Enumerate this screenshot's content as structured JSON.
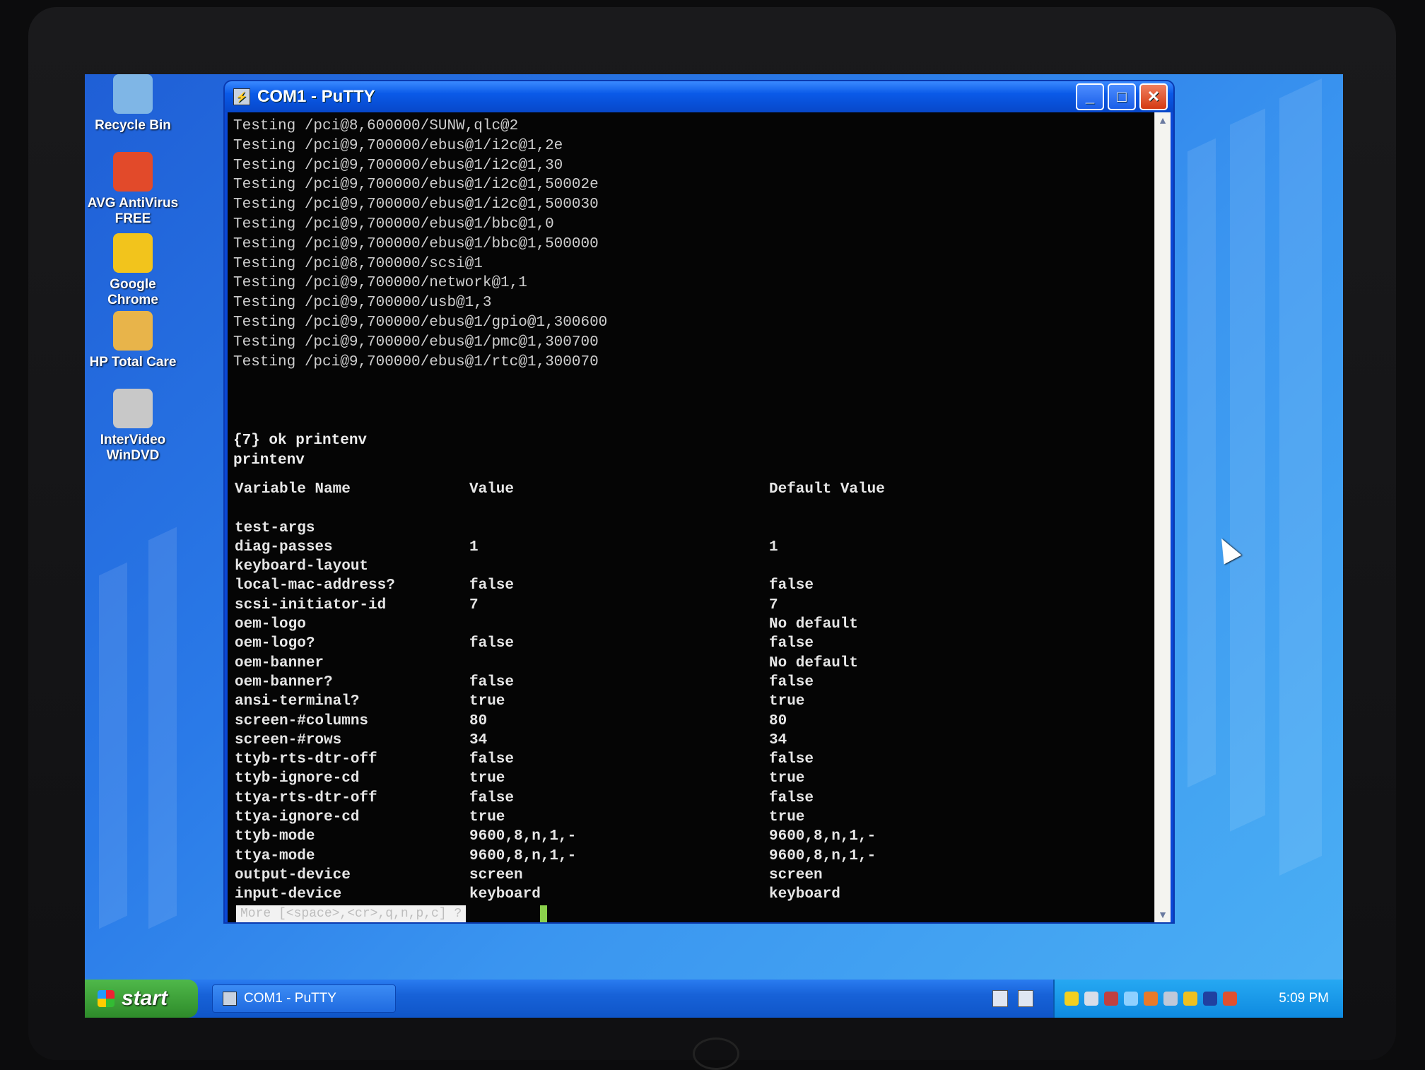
{
  "desktop": {
    "icons": [
      {
        "label_line1": "Recycle Bin",
        "label_line2": "",
        "icon": "recycle-bin-icon",
        "color": "#7fb6e6"
      },
      {
        "label_line1": "AVG AntiVirus",
        "label_line2": "FREE",
        "icon": "avg-antivirus-icon",
        "color": "#e24a2a"
      },
      {
        "label_line1": "Google Chrome",
        "label_line2": "",
        "icon": "chrome-icon",
        "color": "#f2c41c"
      },
      {
        "label_line1": "HP Total Care",
        "label_line2": "",
        "icon": "hp-total-care-icon",
        "color": "#e8b44a"
      },
      {
        "label_line1": "InterVideo",
        "label_line2": "WinDVD",
        "icon": "windvd-icon",
        "color": "#c8c8c8"
      }
    ]
  },
  "window": {
    "title": "COM1 - PuTTY",
    "buttons": {
      "minimize": "_",
      "maximize": "□",
      "close": "✕"
    }
  },
  "terminal": {
    "lines": [
      "Testing /pci@8,600000/SUNW,qlc@2",
      "Testing /pci@9,700000/ebus@1/i2c@1,2e",
      "Testing /pci@9,700000/ebus@1/i2c@1,30",
      "Testing /pci@9,700000/ebus@1/i2c@1,50002e",
      "Testing /pci@9,700000/ebus@1/i2c@1,500030",
      "Testing /pci@9,700000/ebus@1/bbc@1,0",
      "Testing /pci@9,700000/ebus@1/bbc@1,500000",
      "Testing /pci@8,700000/scsi@1",
      "Testing /pci@9,700000/network@1,1",
      "Testing /pci@9,700000/usb@1,3",
      "Testing /pci@9,700000/ebus@1/gpio@1,300600",
      "Testing /pci@9,700000/ebus@1/pmc@1,300700",
      "Testing /pci@9,700000/ebus@1/rtc@1,300070",
      "",
      "",
      "",
      "{7} ok printenv",
      "printenv"
    ],
    "env_header": {
      "name": "Variable Name",
      "value": "Value",
      "default": "Default Value"
    },
    "env_rows": [
      {
        "name": "",
        "value": "",
        "default": ""
      },
      {
        "name": "test-args",
        "value": "",
        "default": ""
      },
      {
        "name": "diag-passes",
        "value": "1",
        "default": "1"
      },
      {
        "name": "keyboard-layout",
        "value": "",
        "default": ""
      },
      {
        "name": "local-mac-address?",
        "value": "false",
        "default": "false"
      },
      {
        "name": "scsi-initiator-id",
        "value": "7",
        "default": "7"
      },
      {
        "name": "oem-logo",
        "value": "",
        "default": "No default"
      },
      {
        "name": "oem-logo?",
        "value": "false",
        "default": "false"
      },
      {
        "name": "oem-banner",
        "value": "",
        "default": "No default"
      },
      {
        "name": "oem-banner?",
        "value": "false",
        "default": "false"
      },
      {
        "name": "ansi-terminal?",
        "value": "true",
        "default": "true"
      },
      {
        "name": "screen-#columns",
        "value": "80",
        "default": "80"
      },
      {
        "name": "screen-#rows",
        "value": "34",
        "default": "34"
      },
      {
        "name": "ttyb-rts-dtr-off",
        "value": "false",
        "default": "false"
      },
      {
        "name": "ttyb-ignore-cd",
        "value": "true",
        "default": "true"
      },
      {
        "name": "ttya-rts-dtr-off",
        "value": "false",
        "default": "false"
      },
      {
        "name": "ttya-ignore-cd",
        "value": "true",
        "default": "true"
      },
      {
        "name": "ttyb-mode",
        "value": "9600,8,n,1,-",
        "default": "9600,8,n,1,-"
      },
      {
        "name": "ttya-mode",
        "value": "9600,8,n,1,-",
        "default": "9600,8,n,1,-"
      },
      {
        "name": "output-device",
        "value": "screen",
        "default": "screen"
      },
      {
        "name": "input-device",
        "value": "keyboard",
        "default": "keyboard"
      }
    ],
    "more_prompt": "More [<space>,<cr>,q,n,p,c] ?"
  },
  "taskbar": {
    "start_label": "start",
    "task_button": "COM1 - PuTTY",
    "clock": "5:09 PM"
  },
  "colors": {
    "terminal_bg": "#050505",
    "terminal_fg": "#e6e6e6",
    "titlebar": "#0a5ae8",
    "taskbar": "#1762d8"
  }
}
